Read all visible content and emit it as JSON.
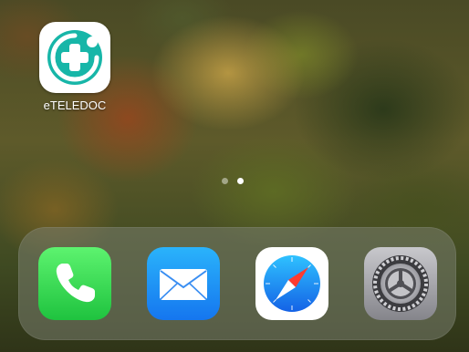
{
  "home_screen": {
    "apps": [
      {
        "label": "eTELEDOC",
        "icon": "eteledoc-icon",
        "brand_color": "#17b6a8"
      }
    ],
    "page_indicator": {
      "pages": 2,
      "current": 2
    }
  },
  "dock": {
    "apps": [
      {
        "icon": "phone-icon",
        "color": "#2fd158"
      },
      {
        "icon": "mail-icon",
        "color": "#1e8cf6"
      },
      {
        "icon": "safari-icon",
        "color": "#1a7cf2"
      },
      {
        "icon": "settings-gear-icon",
        "color": "#8e8e93"
      }
    ]
  }
}
